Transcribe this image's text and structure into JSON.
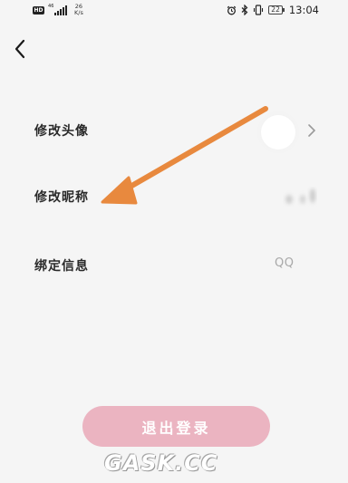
{
  "status_bar": {
    "hd": "HD",
    "signal": "46",
    "net_speed": "26",
    "net_unit": "K/s",
    "battery": "22",
    "time": "13:04"
  },
  "settings": {
    "avatar_label": "修改头像",
    "nickname_label": "修改昵称",
    "binding_label": "绑定信息",
    "binding_value": "QQ"
  },
  "logout_label": "退出登录",
  "watermark": "GASK.CC",
  "colors": {
    "logout_bg": "#ebb4c1",
    "arrow": "#e8893e"
  },
  "icons": [
    "back-chevron-icon",
    "chevron-right-icon",
    "alarm-icon",
    "bluetooth-icon",
    "vibrate-icon",
    "battery-icon",
    "signal-icon",
    "arrow-annotation"
  ]
}
